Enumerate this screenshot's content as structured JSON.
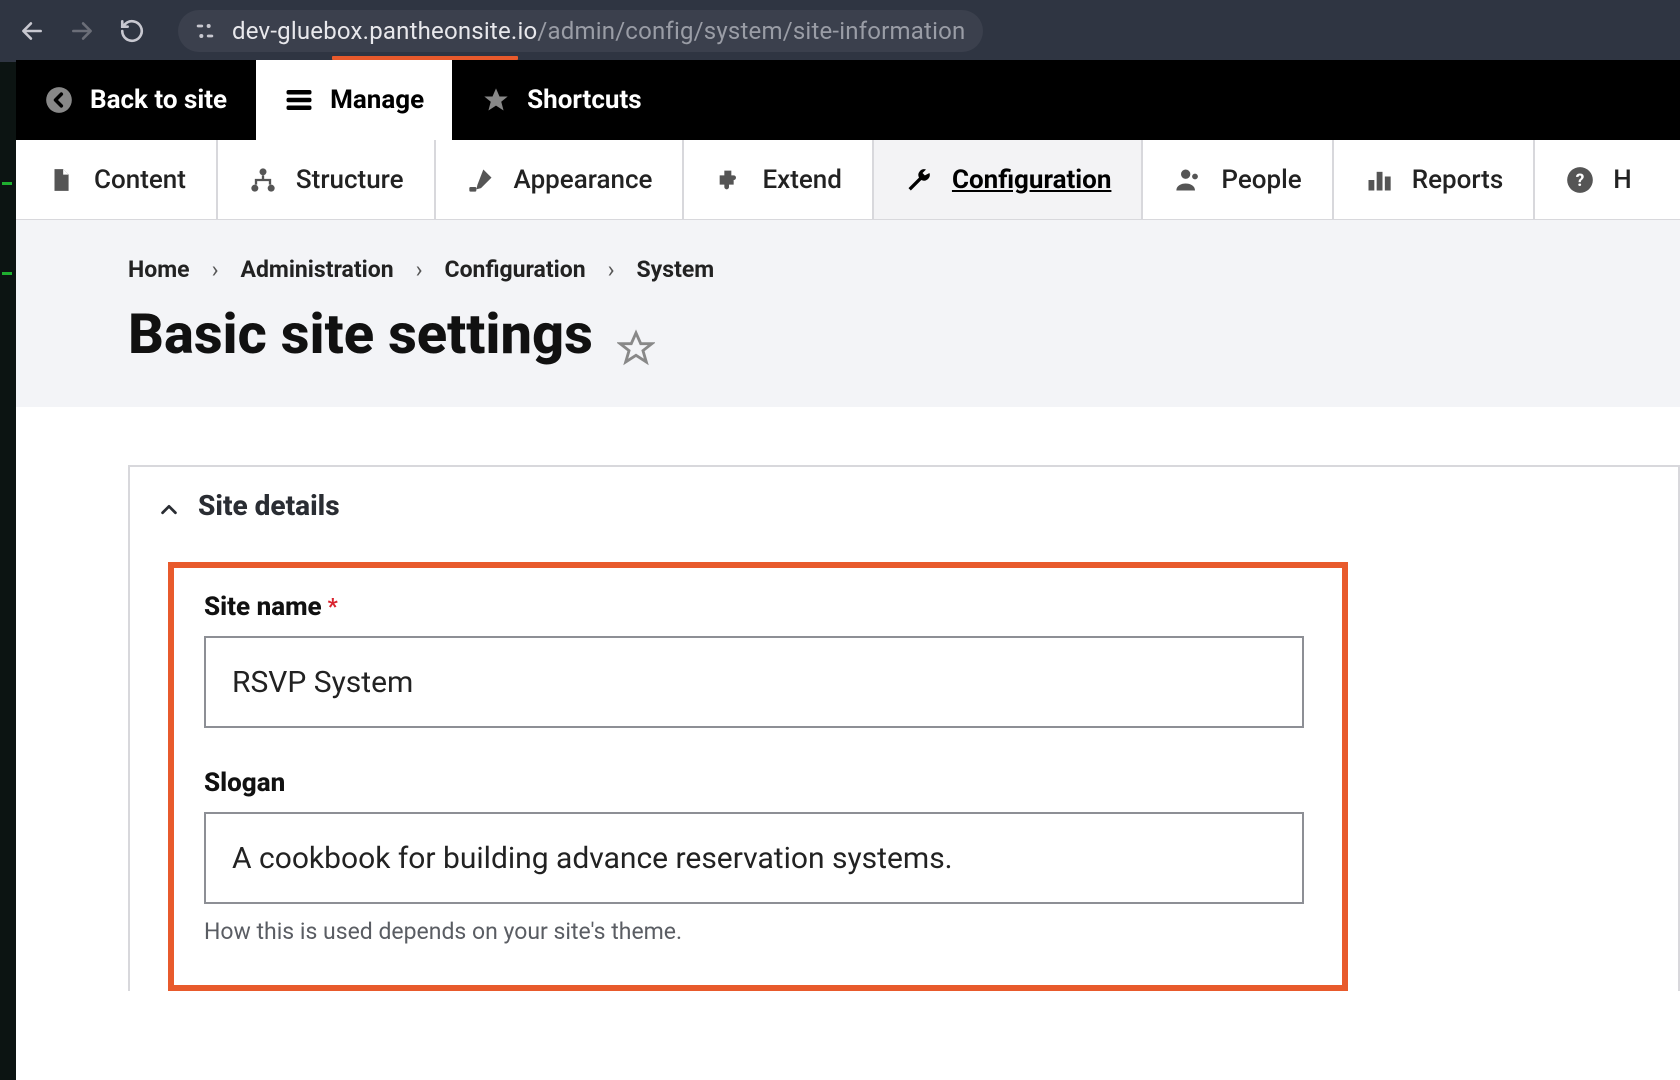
{
  "browser": {
    "url_host": "dev-gluebox.pantheonsite.io",
    "url_path": "/admin/config/system/site-information"
  },
  "toolbar": {
    "back_to_site": "Back to site",
    "manage": "Manage",
    "shortcuts": "Shortcuts"
  },
  "admin_tabs": {
    "content": "Content",
    "structure": "Structure",
    "appearance": "Appearance",
    "extend": "Extend",
    "configuration": "Configuration",
    "people": "People",
    "reports": "Reports",
    "help_initial": "H"
  },
  "breadcrumb": {
    "home": "Home",
    "administration": "Administration",
    "configuration": "Configuration",
    "system": "System"
  },
  "page": {
    "title": "Basic site settings"
  },
  "details": {
    "site_details_heading": "Site details"
  },
  "form": {
    "site_name_label": "Site name",
    "site_name_value": "RSVP System",
    "slogan_label": "Slogan",
    "slogan_value": "A cookbook for building advance reservation systems.",
    "slogan_help": "How this is used depends on your site's theme."
  }
}
